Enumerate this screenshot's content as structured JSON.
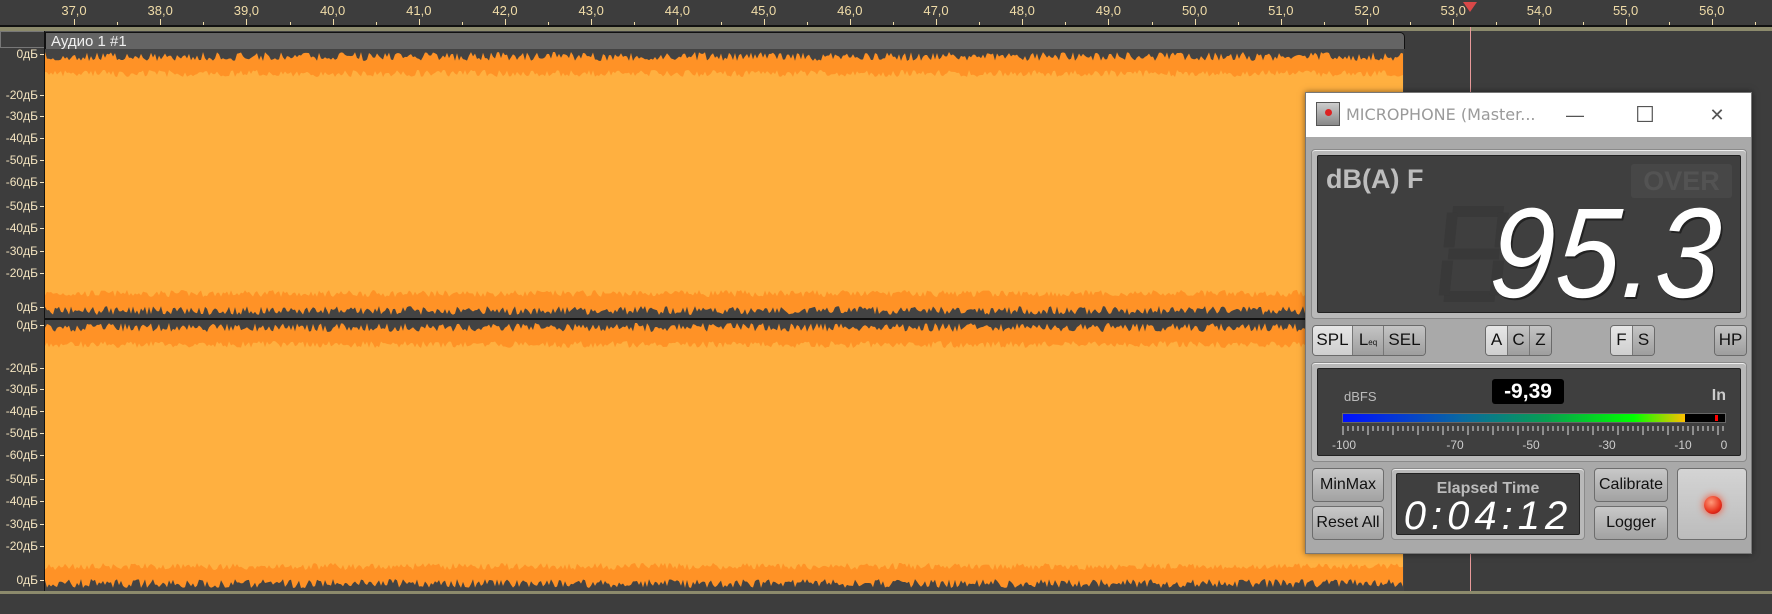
{
  "ruler": {
    "labels": [
      "37,0",
      "38,0",
      "39,0",
      "40,0",
      "41,0",
      "42,0",
      "43,0",
      "44,0",
      "45,0",
      "46,0",
      "47,0",
      "48,0",
      "49,0",
      "50,0",
      "51,0",
      "52,0",
      "53,0",
      "54,0",
      "55,0",
      "56,0"
    ],
    "playhead_seconds": 53.2
  },
  "track": {
    "clip_title": "Аудио 1 #1",
    "scale_labels": [
      "0дБ",
      "-20дБ",
      "-30дБ",
      "-40дБ",
      "-50дБ",
      "-60дБ",
      "-50дБ",
      "-40дБ",
      "-30дБ",
      "-20дБ",
      "0дБ"
    ]
  },
  "colors": {
    "wave_light": "#ffb040",
    "wave_dark": "#ff9226",
    "background": "#3d3d3d",
    "ruler_text": "#f0dca8"
  },
  "meter_window": {
    "title": "MICROPHONE (Master...",
    "controls": {
      "minimize": "—",
      "maximize": "☐",
      "close": "✕"
    },
    "display": {
      "unit": "dB(A) F",
      "over": "OVER",
      "value": "95.3"
    },
    "mode_buttons": [
      "SPL",
      "L",
      "SEL"
    ],
    "leq_sub": "eq",
    "active_mode": "SPL",
    "weight_buttons": [
      "A",
      "C",
      "Z"
    ],
    "active_weight": "A",
    "time_buttons": [
      "F",
      "S"
    ],
    "active_time": "F",
    "hp_button": "HP",
    "level": {
      "label": "dBFS",
      "value": "-9,39",
      "value_num": -9.39,
      "channel": "In",
      "scale_labels": [
        "-100",
        "-70",
        "-50",
        "-30",
        "-10",
        "0"
      ],
      "peak_db": -1.5
    },
    "buttons": {
      "minmax": "MinMax",
      "reset": "Reset All",
      "calibrate": "Calibrate",
      "logger": "Logger"
    },
    "elapsed": {
      "title": "Elapsed Time",
      "value": "0:04:12"
    },
    "record_icon": "red-led"
  }
}
